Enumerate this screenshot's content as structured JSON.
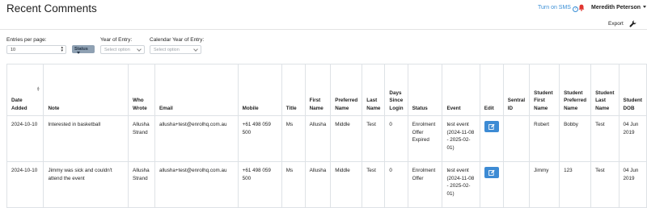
{
  "header": {
    "title": "Recent Comments",
    "sms_link": "Turn on SMS",
    "user_name": "Meredith Peterson"
  },
  "toolbar": {
    "export_label": "Export"
  },
  "filters": {
    "entries_label": "Entries per page:",
    "entries_value": "10",
    "status_label": "Status",
    "year_label": "Year of Entry:",
    "year_placeholder": "Select option",
    "calendar_label": "Calendar Year of Entry:",
    "calendar_placeholder": "Select option"
  },
  "table": {
    "columns": [
      "Date Added",
      "Note",
      "Who Wrote",
      "Email",
      "Mobile",
      "Title",
      "First Name",
      "Preferred Name",
      "Last Name",
      "Days Since Login",
      "Status",
      "Event",
      "Edit",
      "Sentral ID",
      "Student First Name",
      "Student Preferred Name",
      "Student Last Name",
      "Student DOB"
    ],
    "rows": [
      {
        "date_added": "2024-10-10",
        "note": "Interested in basketball",
        "who_wrote": "Allusha Strand",
        "email": "allusha+test@enrolhq.com.au",
        "mobile": "+61 498 059 500",
        "title": "Ms",
        "first_name": "Allusha",
        "preferred_name": "Middle",
        "last_name": "Test",
        "days_since_login": "0",
        "status": "Enrolment Offer Expired",
        "event": "test event (2024-11-08 - 2025-02-01)",
        "sentral_id": "",
        "student_first_name": "Robert",
        "student_preferred_name": "Bobby",
        "student_last_name": "Test",
        "student_dob": "04 Jun 2019"
      },
      {
        "date_added": "2024-10-10",
        "note": "Jimmy was sick and couldn't attend the event",
        "who_wrote": "Allusha Strand",
        "email": "allusha+test@enrolhq.com.au",
        "mobile": "+61 498 059 500",
        "title": "Ms",
        "first_name": "Allusha",
        "preferred_name": "Middle",
        "last_name": "Test",
        "days_since_login": "0",
        "status": "Enrolment Offer",
        "event": "test event (2024-11-08 - 2025-02-01)",
        "sentral_id": "",
        "student_first_name": "Jimmy",
        "student_preferred_name": "123",
        "student_last_name": "Test",
        "student_dob": "04 Jun 2019"
      }
    ]
  },
  "colors": {
    "link": "#3a8fd6",
    "bell": "#e0342f",
    "edit_button": "#3d8bd4",
    "status_button": "#8fa1b3"
  },
  "icons": [
    "help-icon",
    "bell-icon",
    "caret-down-icon",
    "wrench-icon",
    "edit-icon",
    "sort-icon"
  ]
}
